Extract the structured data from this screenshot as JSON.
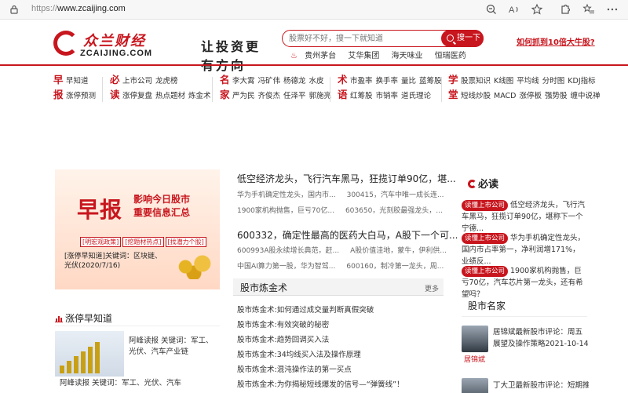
{
  "browser": {
    "url_scheme": "https://",
    "url_host": "www.zcaijing.com",
    "icons": [
      "lock-icon",
      "zoom-out-icon",
      "read-aloud-icon",
      "favorite-star-icon",
      "extensions-icon",
      "favorites-list-icon",
      "more-icon"
    ]
  },
  "header": {
    "logo_cn": "众兰财经",
    "logo_en": "ZCAIJING.COM",
    "slogan": "让投资更有方向",
    "search_placeholder": "股票好不好，搜一下就知道",
    "search_button": "搜一下",
    "hot_tags": [
      "贵州茅台",
      "艾华集团",
      "海天味业",
      "恒瑞医药"
    ],
    "promo_link": "如何抓到10倍大牛股?"
  },
  "nav": [
    {
      "rows": [
        {
          "head": "早",
          "links": [
            "早知道"
          ]
        },
        {
          "head": "报",
          "links": [
            "涨停预测"
          ]
        }
      ]
    },
    {
      "rows": [
        {
          "head": "必",
          "links": [
            "上市公司",
            "龙虎榜"
          ]
        },
        {
          "head": "读",
          "links": [
            "涨停复盘",
            "热点题材",
            "炼金术"
          ]
        }
      ]
    },
    {
      "rows": [
        {
          "head": "名",
          "links": [
            "李大霄",
            "冯矿伟",
            "杨德龙",
            "水皮"
          ]
        },
        {
          "head": "家",
          "links": [
            "严为民",
            "齐俊杰",
            "任泽平",
            "郭施亮"
          ]
        }
      ]
    },
    {
      "rows": [
        {
          "head": "术",
          "links": [
            "市盈率",
            "换手率",
            "量比",
            "蓝筹股"
          ]
        },
        {
          "head": "语",
          "links": [
            "红筹股",
            "市销率",
            "道氏理论"
          ]
        }
      ]
    },
    {
      "rows": [
        {
          "head": "学",
          "links": [
            "股票知识",
            "K线图",
            "平均线",
            "分时图",
            "KDJ指标"
          ]
        },
        {
          "head": "堂",
          "links": [
            "短线炒股",
            "MACD",
            "涨停板",
            "强势股",
            "缠中说禅"
          ]
        }
      ]
    }
  ],
  "banner": {
    "big": "早报",
    "side_line1": "影响今日股市",
    "side_line2": "重要信息汇总",
    "tags": [
      "[明宏观政策]",
      "[挖题材热点]",
      "[找潜力个股]"
    ],
    "caption": "[涨停早知道]关键词：区块链、光伏(2020/7/16)"
  },
  "news": {
    "headline1": "低空经济龙头，飞行汽车黑马，狂揽订单90亿，堪...",
    "sub1a": [
      "华为手机确定性龙头，国内市...",
      "300415，汽车中唯一成长连..."
    ],
    "sub1b": [
      "1900家机构抛售，巨亏70亿...",
      "603650，光刻胶最强龙头，..."
    ],
    "headline2": "600332，确定性最高的医药大白马，A股下一个可...",
    "sub2a": [
      "600993A股永续增长典范，赶...",
      "A股价值洼地，蒙牛，伊利供..."
    ],
    "sub2b": [
      "中国AI算力第一股，华为智驾...",
      "600160，制冷第一龙头，周..."
    ]
  },
  "section": {
    "title": "股市炼金术",
    "more": "更多",
    "articles": [
      "股市炼金术:如何通过成交量判断真假突破",
      "股市炼金术:有效突破的秘密",
      "股市炼金术:趋势回调买入法",
      "股市炼金术:34均线买入法及操作原理",
      "股市炼金术:混沌操作法的第一买点",
      "股市炼金术:为你揭秘短线爆发的信号—“弹簧线”！"
    ]
  },
  "zhangting": {
    "title": "涨停早知道",
    "side_text": "阿峰读报 关键词：军工、光伏、汽车产业链",
    "bottom_text": "阿峰读报 关键词：军工、光伏、汽车"
  },
  "must_read": {
    "title": "必读",
    "items": [
      {
        "tag": "读懂上市公司",
        "text": "低空经济龙头，飞行汽车黑马，狂揽订单90亿，堪称下一个宁德..."
      },
      {
        "tag": "读懂上市公司",
        "text": "华为手机确定性龙头，国内市占率第一，净利润增171%，业绩反..."
      },
      {
        "tag": "读懂上市公司",
        "text": "1900家机构抛售，巨亏70亿，汽车芯片第一龙头，还有希望吗？"
      }
    ]
  },
  "famous": {
    "title": "股市名家",
    "items": [
      {
        "name": "居锦斌",
        "text": "居锦斌最新股市评论：周五展望及操作策略2021-10-14"
      },
      {
        "name": "丁大卫",
        "text": "丁大卫最新股市评论：短期推"
      }
    ]
  },
  "colors": {
    "brand_red": "#c8161e"
  }
}
